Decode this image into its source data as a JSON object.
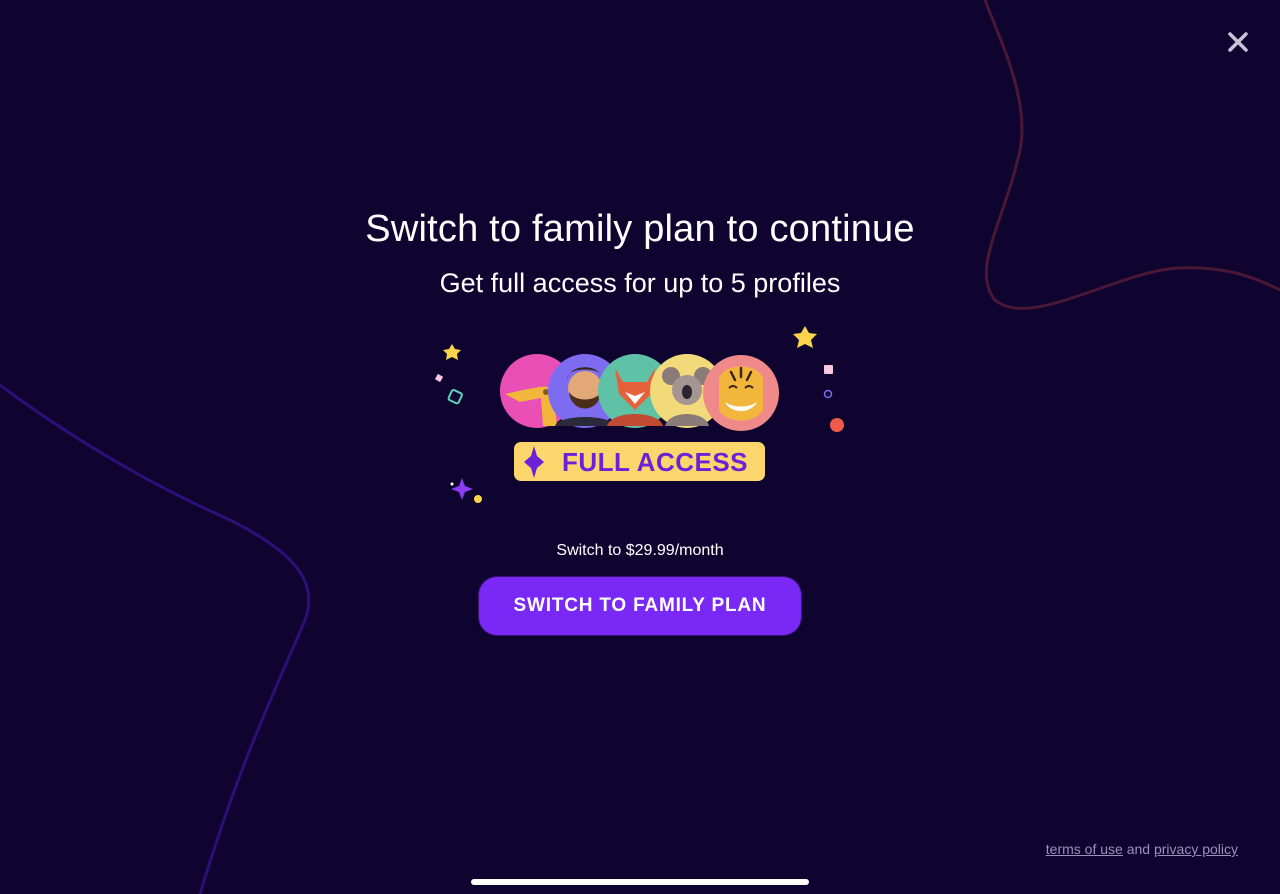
{
  "modal": {
    "title": "Switch to family plan to continue",
    "subtitle": "Get full access for up to 5 profiles",
    "badge_label": "FULL ACCESS",
    "price_text": "Switch to $29.99/month",
    "cta_label": "SWITCH TO FAMILY PLAN",
    "close_icon": "close-icon"
  },
  "profiles": [
    {
      "icon": "giraffe-avatar",
      "bg": "#e94fb5"
    },
    {
      "icon": "bearded-man-avatar",
      "bg": "#7d6cf0"
    },
    {
      "icon": "fox-avatar",
      "bg": "#5fc2a6"
    },
    {
      "icon": "koala-avatar",
      "bg": "#f2d97a"
    },
    {
      "icon": "tiger-avatar",
      "bg": "#f08a8a"
    }
  ],
  "footer": {
    "terms_label": "terms of use",
    "and_text": "and",
    "privacy_label": "privacy policy"
  },
  "colors": {
    "background": "#0f0330",
    "accent": "#7a28f5",
    "badge": "#fcd66c",
    "badge_text": "#6b21d8"
  }
}
